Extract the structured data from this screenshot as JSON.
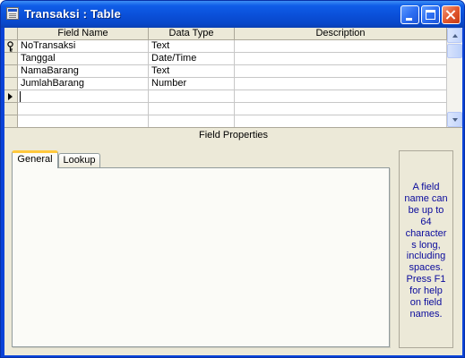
{
  "window": {
    "title": "Transaksi : Table"
  },
  "grid": {
    "headers": [
      "Field Name",
      "Data Type",
      "Description"
    ],
    "rows": [
      {
        "field_name": "NoTransaksi",
        "data_type": "Text",
        "description": "",
        "primary_key": true
      },
      {
        "field_name": "Tanggal",
        "data_type": "Date/Time",
        "description": ""
      },
      {
        "field_name": "NamaBarang",
        "data_type": "Text",
        "description": ""
      },
      {
        "field_name": "JumlahBarang",
        "data_type": "Number",
        "description": ""
      },
      {
        "field_name": "",
        "data_type": "",
        "description": "",
        "current": true
      },
      {
        "field_name": "",
        "data_type": "",
        "description": ""
      },
      {
        "field_name": "",
        "data_type": "",
        "description": ""
      }
    ]
  },
  "field_properties": {
    "header": "Field Properties",
    "tabs": [
      {
        "label": "General",
        "selected": true
      },
      {
        "label": "Lookup",
        "selected": false
      }
    ],
    "help_text": "A field\nname can\nbe up to\n64\ncharacter\ns long,\nincluding\nspaces.\nPress F1\nfor help\non field\nnames."
  },
  "icons": {
    "title_icon": "table-icon",
    "primary_key": "key-icon",
    "current_row": "row-pointer-icon"
  },
  "colors": {
    "title_bar": "#0a4fd8",
    "help_text": "#0a0a9c",
    "active_tab_accent": "#ffc83c"
  }
}
